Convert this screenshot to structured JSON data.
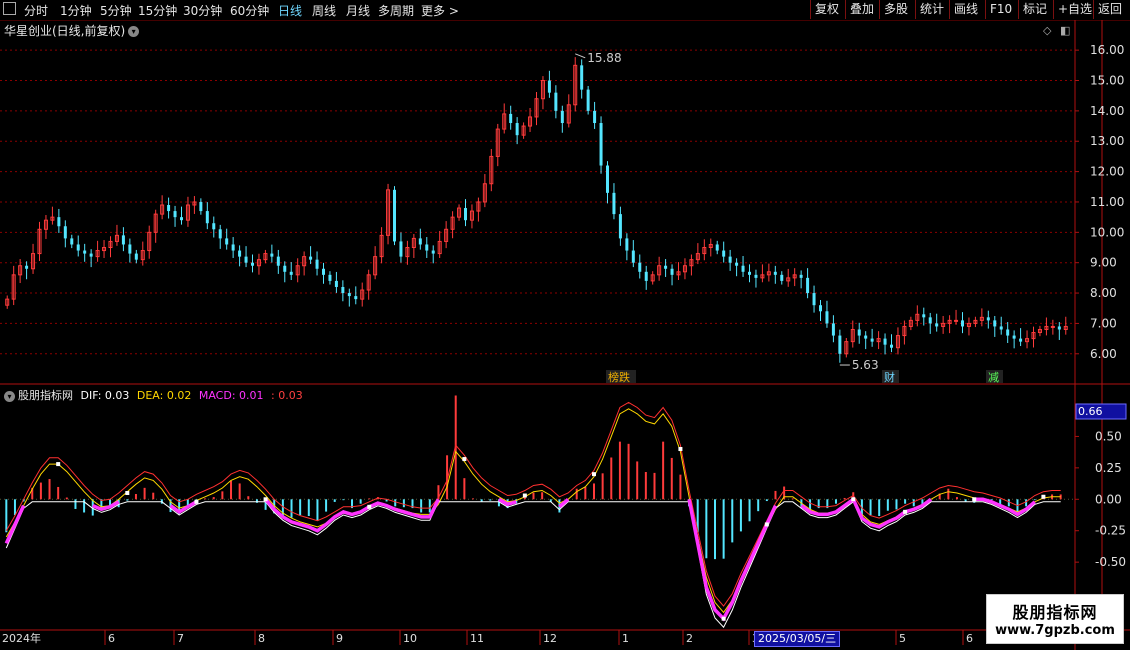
{
  "toolbar": {
    "tabs": [
      "分时",
      "1分钟",
      "5分钟",
      "15分钟",
      "30分钟",
      "60分钟",
      "日线",
      "周线",
      "月线",
      "多周期",
      "更多 >"
    ],
    "active_tab": "日线",
    "right_buttons": [
      "复权",
      "叠加",
      "多股",
      "统计",
      "画线",
      "F10",
      "标记",
      "+自选",
      "返回"
    ]
  },
  "main": {
    "title": "华星创业(日线,前复权)",
    "high_label": "15.88",
    "low_label": "5.63",
    "events": [
      {
        "text": "榜跌",
        "color": "#f0b000"
      },
      {
        "text": "财",
        "color": "#6fd7ff"
      },
      {
        "text": "减",
        "color": "#5aff5a"
      }
    ],
    "y_ticks": [
      "16.00",
      "15.00",
      "14.00",
      "13.00",
      "12.00",
      "11.00",
      "10.00",
      "9.00",
      "8.00",
      "7.00",
      "6.00"
    ]
  },
  "indicator": {
    "name": "股朋指标网",
    "dif_label": "DIF: 0.03",
    "dea_label": "DEA: 0.02",
    "macd_label": "MACD: 0.01",
    "extra_label": ": 0.03",
    "current_value": "0.66",
    "y_ticks": [
      "0.50",
      "0.25",
      "0.00",
      "-0.25",
      "-0.50"
    ]
  },
  "x_axis": {
    "labels": [
      "2024年",
      "6",
      "7",
      "8",
      "9",
      "10",
      "11",
      "12",
      "1",
      "2",
      "3",
      "5",
      "6"
    ],
    "cursor_date": "2025/03/05/三"
  },
  "watermark": {
    "line1": "股朋指标网",
    "line2": "www.7gpzb.com"
  },
  "colors": {
    "up": "#ff3b3b",
    "down": "#54e6ff",
    "grid": "#8b0000",
    "dif": "#ffffff",
    "dea": "#ffd700",
    "macd": "#ff33ff"
  },
  "chart_data": {
    "type": "candlestick",
    "ylim": [
      5.4,
      16.4
    ],
    "closes": [
      7.8,
      8.6,
      8.9,
      8.8,
      9.3,
      10.1,
      10.4,
      10.5,
      10.2,
      9.8,
      9.6,
      9.4,
      9.3,
      9.2,
      9.4,
      9.5,
      9.7,
      9.9,
      9.6,
      9.3,
      9.1,
      9.4,
      10.0,
      10.6,
      10.9,
      10.7,
      10.5,
      10.4,
      10.9,
      11.0,
      10.7,
      10.3,
      10.1,
      9.8,
      9.6,
      9.4,
      9.2,
      9.0,
      8.9,
      9.1,
      9.3,
      9.2,
      8.9,
      8.7,
      8.6,
      8.9,
      9.2,
      9.1,
      8.8,
      8.6,
      8.4,
      8.2,
      8.0,
      7.9,
      7.8,
      8.1,
      8.6,
      9.2,
      9.9,
      11.4,
      9.7,
      9.2,
      9.5,
      9.8,
      9.6,
      9.4,
      9.3,
      9.7,
      10.1,
      10.5,
      10.8,
      10.4,
      10.7,
      11.0,
      11.6,
      12.5,
      13.4,
      13.9,
      13.6,
      13.2,
      13.5,
      13.8,
      14.4,
      15.0,
      14.6,
      14.0,
      13.6,
      14.2,
      15.5,
      14.7,
      14.0,
      13.6,
      12.2,
      11.3,
      10.6,
      9.8,
      9.4,
      9.0,
      8.7,
      8.4,
      8.6,
      8.9,
      8.8,
      8.6,
      8.7,
      8.9,
      9.1,
      9.3,
      9.5,
      9.6,
      9.4,
      9.2,
      9.0,
      8.9,
      8.7,
      8.6,
      8.5,
      8.6,
      8.7,
      8.6,
      8.4,
      8.5,
      8.6,
      8.5,
      8.0,
      7.6,
      7.4,
      7.0,
      6.6,
      6.0,
      6.4,
      6.8,
      6.6,
      6.5,
      6.4,
      6.5,
      6.3,
      6.2,
      6.6,
      6.9,
      7.1,
      7.3,
      7.2,
      7.0,
      6.9,
      7.0,
      7.1,
      7.1,
      6.9,
      7.0,
      7.1,
      7.2,
      7.1,
      6.9,
      6.8,
      6.6,
      6.5,
      6.4,
      6.5,
      6.7,
      6.8,
      6.9,
      6.9,
      6.8,
      6.9
    ],
    "dif": [
      -0.35,
      -0.2,
      -0.05,
      0.1,
      0.22,
      0.3,
      0.28,
      0.2,
      0.1,
      0.02,
      -0.05,
      -0.08,
      -0.06,
      -0.02,
      0.05,
      0.12,
      0.18,
      0.15,
      0.06,
      -0.05,
      -0.1,
      -0.06,
      -0.02,
      0.02,
      0.05,
      0.1,
      0.18,
      0.2,
      0.15,
      0.08,
      0.0,
      -0.08,
      -0.14,
      -0.18,
      -0.2,
      -0.22,
      -0.25,
      -0.2,
      -0.14,
      -0.1,
      -0.12,
      -0.1,
      -0.06,
      -0.03,
      -0.05,
      -0.08,
      -0.1,
      -0.12,
      -0.14,
      -0.14,
      0.0,
      0.2,
      0.6,
      0.32,
      0.18,
      0.1,
      0.05,
      0.0,
      -0.04,
      -0.02,
      0.03,
      0.07,
      0.08,
      0.02,
      -0.06,
      0.0,
      0.08,
      0.12,
      0.2,
      0.35,
      0.55,
      0.75,
      0.78,
      0.7,
      0.62,
      0.6,
      0.75,
      0.62,
      0.4,
      0.0,
      -0.35,
      -0.7,
      -0.88,
      -0.95,
      -0.82,
      -0.65,
      -0.5,
      -0.35,
      -0.2,
      -0.05,
      0.05,
      0.02,
      -0.05,
      -0.1,
      -0.12,
      -0.12,
      -0.1,
      -0.05,
      0.0,
      -0.15,
      -0.2,
      -0.22,
      -0.18,
      -0.15,
      -0.1,
      -0.08,
      -0.05,
      0.0,
      0.05,
      0.08,
      0.05,
      0.02,
      0.0,
      0.0,
      -0.02,
      -0.05,
      -0.08,
      -0.12,
      -0.08,
      -0.02,
      0.02,
      0.03,
      0.03
    ],
    "dea": [
      -0.3,
      -0.18,
      -0.05,
      0.08,
      0.2,
      0.28,
      0.28,
      0.22,
      0.14,
      0.06,
      -0.01,
      -0.06,
      -0.05,
      0.0,
      0.06,
      0.12,
      0.17,
      0.15,
      0.08,
      -0.02,
      -0.07,
      -0.05,
      -0.01,
      0.02,
      0.05,
      0.09,
      0.15,
      0.18,
      0.16,
      0.1,
      0.03,
      -0.05,
      -0.11,
      -0.15,
      -0.18,
      -0.2,
      -0.22,
      -0.19,
      -0.15,
      -0.11,
      -0.11,
      -0.1,
      -0.07,
      -0.04,
      -0.05,
      -0.07,
      -0.09,
      -0.11,
      -0.12,
      -0.12,
      -0.04,
      0.1,
      0.38,
      0.3,
      0.2,
      0.12,
      0.06,
      0.02,
      -0.02,
      -0.01,
      0.02,
      0.06,
      0.07,
      0.03,
      -0.03,
      0.0,
      0.06,
      0.1,
      0.18,
      0.32,
      0.5,
      0.68,
      0.72,
      0.68,
      0.62,
      0.6,
      0.68,
      0.58,
      0.38,
      0.02,
      -0.3,
      -0.62,
      -0.82,
      -0.9,
      -0.8,
      -0.64,
      -0.5,
      -0.36,
      -0.22,
      -0.08,
      0.02,
      0.02,
      -0.03,
      -0.08,
      -0.11,
      -0.11,
      -0.1,
      -0.06,
      -0.02,
      -0.12,
      -0.18,
      -0.2,
      -0.17,
      -0.14,
      -0.1,
      -0.07,
      -0.04,
      0.0,
      0.04,
      0.06,
      0.05,
      0.03,
      0.01,
      0.0,
      -0.02,
      -0.04,
      -0.07,
      -0.1,
      -0.07,
      -0.02,
      0.01,
      0.02,
      0.02
    ]
  }
}
